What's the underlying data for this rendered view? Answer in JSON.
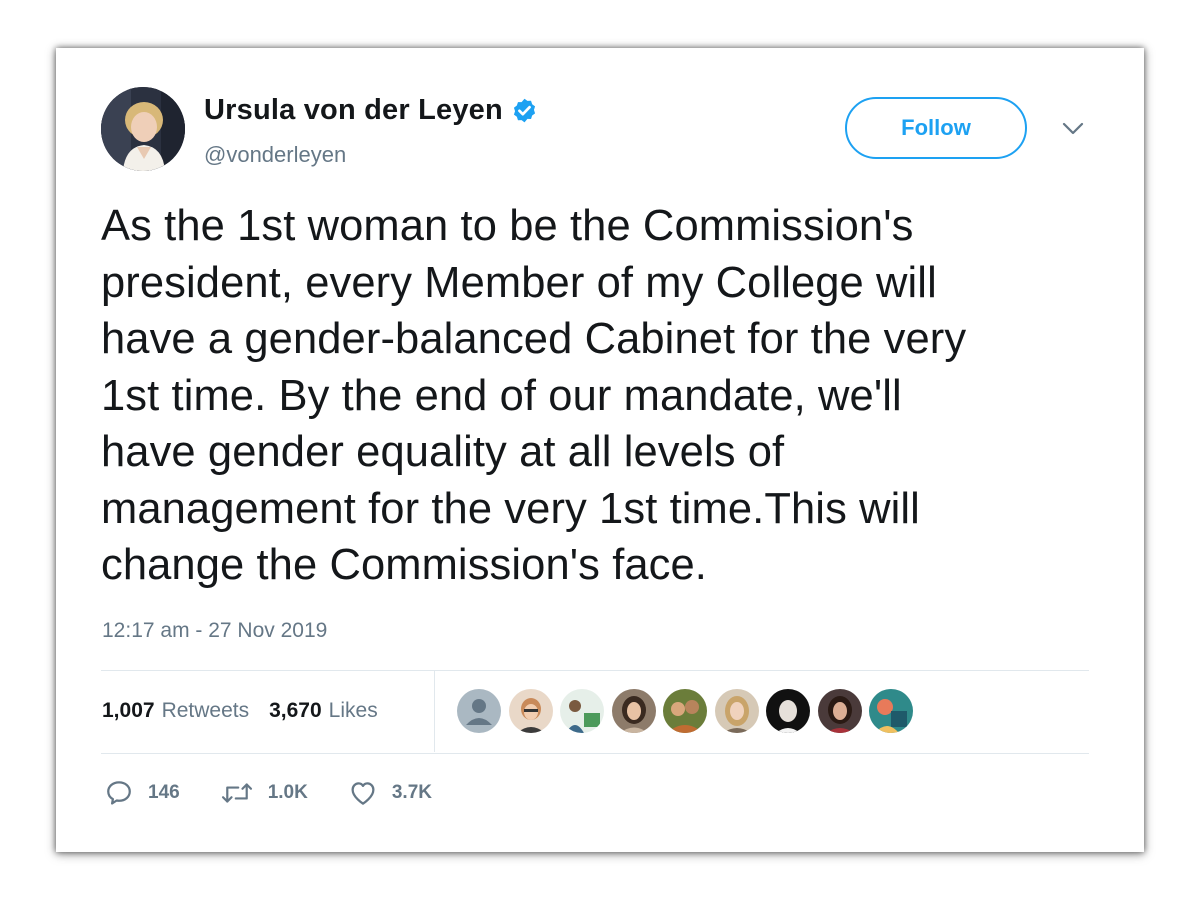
{
  "author": {
    "display_name": "Ursula von der Leyen",
    "handle": "@vonderleyen",
    "avatar_icon": "profile-photo",
    "verified_icon": "verified-badge-icon"
  },
  "follow_label": "Follow",
  "tweet": {
    "text": "As the 1st woman to be the Commission's\npresident, every Member of my College will\nhave a gender-balanced Cabinet for the very\n1st time. By the end of our mandate, we'll\nhave gender equality at all levels of\nmanagement for the very 1st time.This will\nchange the Commission's face.",
    "timestamp": "12:17 am - 27 Nov 2019"
  },
  "stats": {
    "retweets_count": "1,007",
    "retweets_label": "Retweets",
    "likes_count": "3,670",
    "likes_label": "Likes"
  },
  "actions": {
    "reply_count": "146",
    "retweet_count": "1.0K",
    "like_count": "3.7K"
  },
  "colors": {
    "accent": "#1da1f2",
    "text": "#14171a",
    "secondary": "#657786",
    "border": "#e1e8ed"
  }
}
